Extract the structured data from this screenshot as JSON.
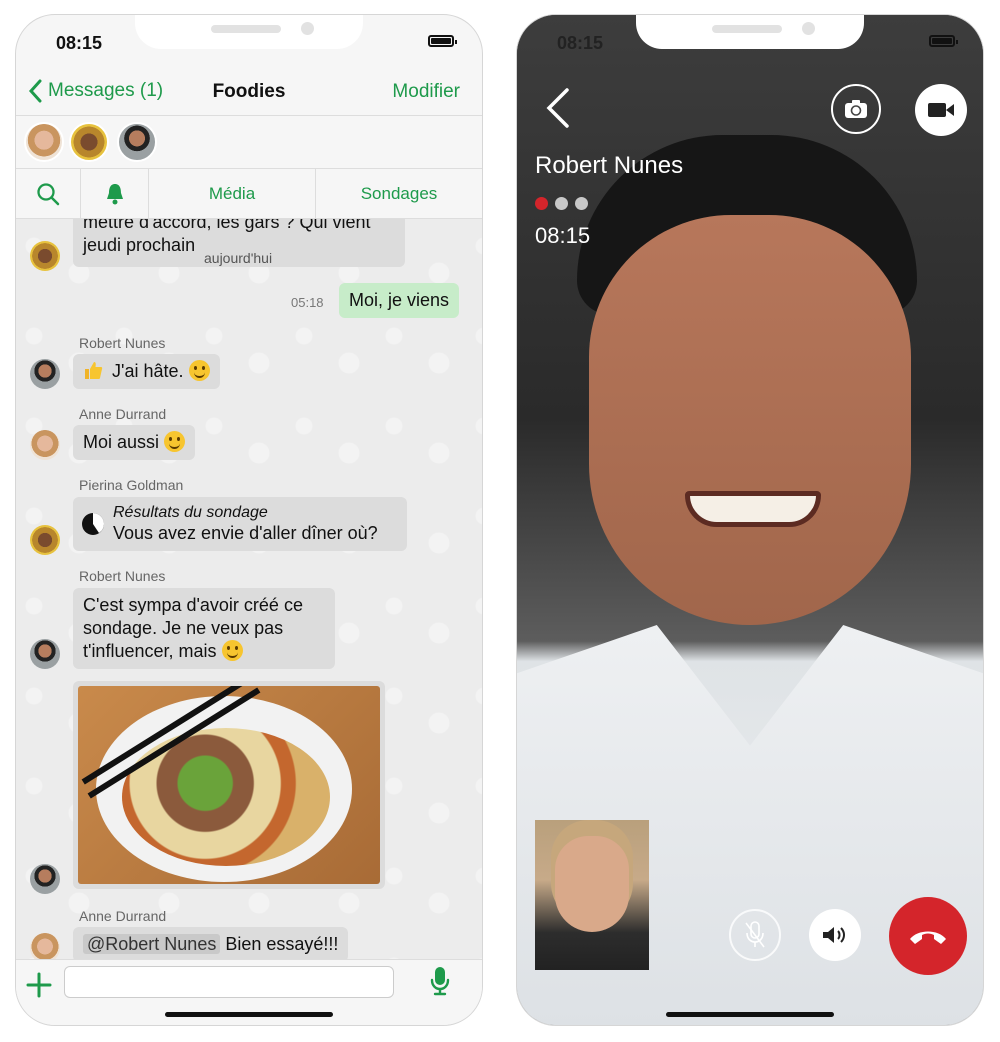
{
  "left_phone": {
    "status_time": "08:15",
    "header": {
      "back_label": "Messages (1)",
      "title": "Foodies",
      "edit_label": "Modifier"
    },
    "toolbar": {
      "media_label": "Média",
      "polls_label": "Sondages"
    },
    "messages": {
      "partial_text": "mettre d'accord, les gars ? Qui vient jeudi prochain",
      "partial_suffix": "? 😀",
      "date_divider": "aujourd'hui",
      "my_time": "05:18",
      "my_text": "Moi, je viens",
      "m1_sender": "Robert Nunes",
      "m1_text": "J'ai hâte.",
      "m2_sender": "Anne Durrand",
      "m2_text": "Moi aussi",
      "m3_sender": "Pierina Goldman",
      "m3_title": "Résultats du sondage",
      "m3_text": "Vous avez envie d'aller dîner où?",
      "m4_sender": "Robert Nunes",
      "m4_text": "C'est sympa d'avoir créé ce sondage. Je ne veux pas t'influencer, mais",
      "m5_sender": "Anne Durrand",
      "m5_mention": "@Robert Nunes",
      "m5_text": "Bien essayé!!!"
    }
  },
  "right_phone": {
    "status_time": "08:15",
    "caller_name": "Robert Nunes",
    "call_duration": "08:15"
  },
  "colors": {
    "accent": "#1e9a4b",
    "hangup": "#d4252b",
    "my_bubble": "#c7ecc9"
  }
}
